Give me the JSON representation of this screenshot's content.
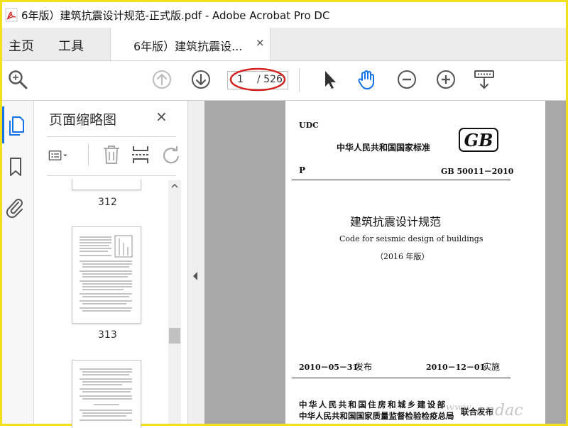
{
  "window": {
    "title": "6年版）建筑抗震设计规范-正式版.pdf - Adobe Acrobat Pro DC"
  },
  "nav": {
    "home": "主页",
    "tools": "工具"
  },
  "document_tab": {
    "label": "6年版）建筑抗震设...",
    "close": "×"
  },
  "page_nav": {
    "current": "1",
    "total": "/ 526"
  },
  "thumbnail_panel": {
    "title": "页面缩略图",
    "close": "×",
    "thumbnails": [
      {
        "label": "312"
      },
      {
        "label": "313"
      }
    ]
  },
  "document": {
    "udc": "UDC",
    "issuer": "中华人民共和国国家标准",
    "gb_logo": "GB",
    "classification": "P",
    "standard_no": "GB 50011－2010",
    "title_cn": "建筑抗震设计规范",
    "title_en": "Code for seismic design of buildings",
    "edition": "（2016 年版）",
    "publish_date": "2010－05－31",
    "publish_label": "发布",
    "effective_date": "2010－12－01",
    "effective_label": "实施",
    "authority_1": "中华人民共和国住房和城乡建设部",
    "authority_2": "中华人民共和国国家质量监督检验检疫总局",
    "joint_label": "联合发布"
  },
  "watermark": "ʷʷʷ.cndac",
  "colors": {
    "accent": "#1473e6",
    "annotation": "#d42323",
    "frame": "#f2e01e",
    "doc_background": "#a8a8a8"
  }
}
